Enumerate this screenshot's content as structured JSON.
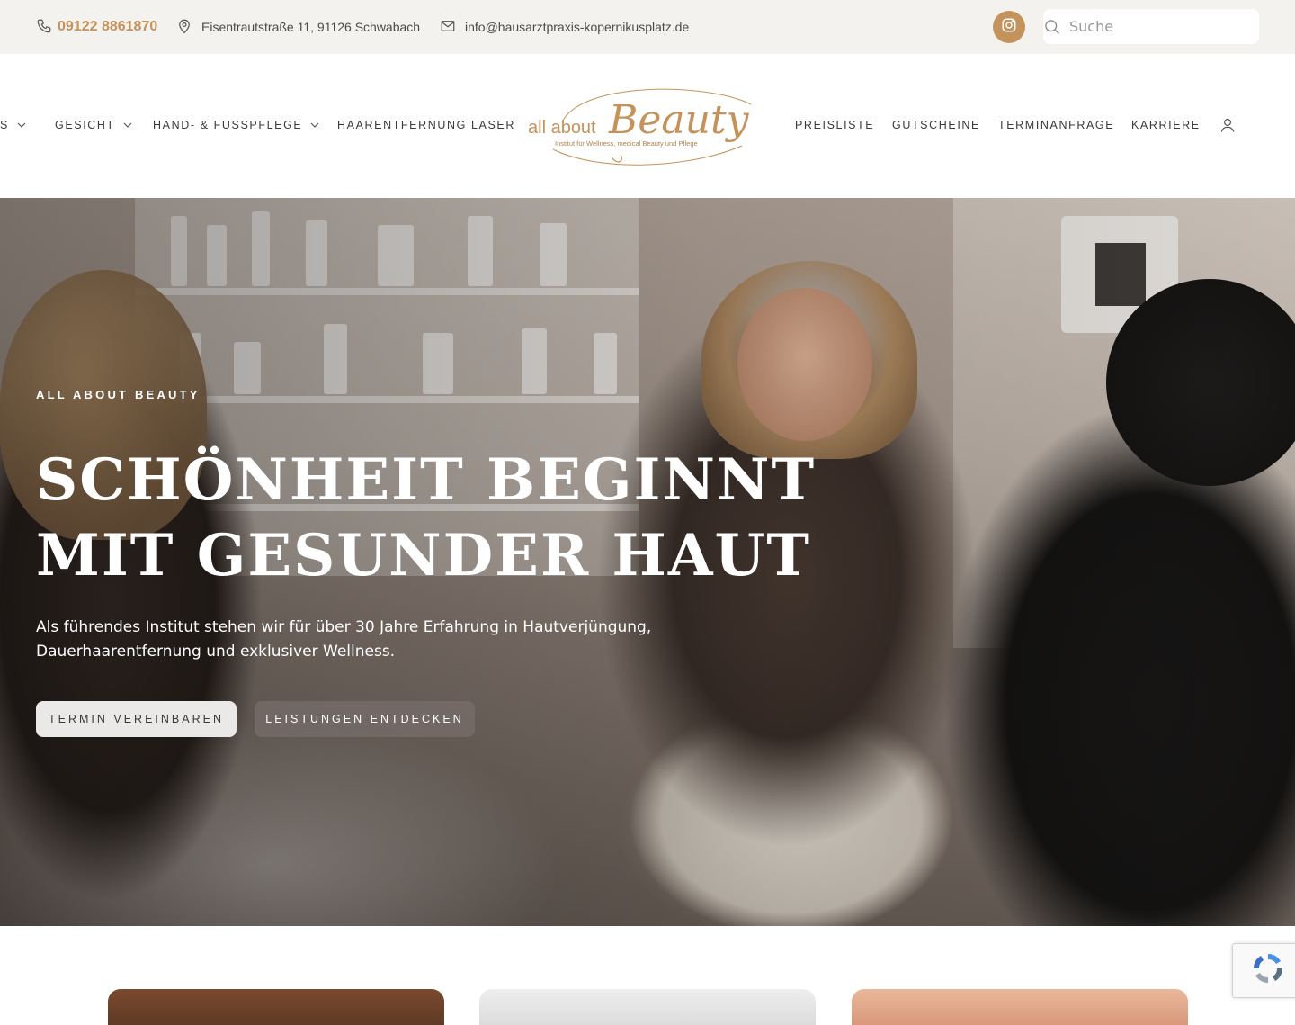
{
  "topbar": {
    "phone": "09122 8861870",
    "address": "Eisentrautstraße 11, 91126 Schwabach",
    "email": "info@hausarztpraxis-kopernikusplatz.de",
    "search_placeholder": "Suche",
    "icons": {
      "phone": "phone-icon",
      "address": "map-pin-icon",
      "email": "mail-icon",
      "instagram": "instagram-icon",
      "search": "search-icon"
    }
  },
  "nav": {
    "left_items": [
      {
        "label": "S",
        "has_dropdown": true
      },
      {
        "label": "GESICHT",
        "has_dropdown": true
      },
      {
        "label": "HAND- & FUSSPFLEGE",
        "has_dropdown": true
      },
      {
        "label": "HAARENTFERNUNG LASER",
        "has_dropdown": false
      }
    ],
    "logo": {
      "line1": "all about",
      "line2": "Beauty",
      "tagline": "Institut für Wellness, medical Beauty und Pflege"
    },
    "right_items": [
      {
        "label": "PREISLISTE"
      },
      {
        "label": "GUTSCHEINE"
      },
      {
        "label": "TERMINANFRAGE"
      },
      {
        "label": "KARRIERE"
      }
    ],
    "account_icon": "user-icon"
  },
  "hero": {
    "eyebrow": "ALL ABOUT BEAUTY",
    "title_line1": "SCHÖNHEIT BEGINNT",
    "title_line2": "MIT GESUNDER HAUT",
    "text": "Als führendes Institut stehen wir für über 30 Jahre Erfahrung in Hautverjüngung, Dauerhaarentfernung und exklusiver Wellness.",
    "primary_button": "TERMIN VEREINBAREN",
    "secondary_button": "LEISTUNGEN ENTDECKEN"
  },
  "colors": {
    "accent": "#c4925b",
    "topbar_bg": "#f4f2ef",
    "text_dark": "#3a3a3a"
  },
  "recaptcha": {
    "icon": "recaptcha-icon"
  }
}
